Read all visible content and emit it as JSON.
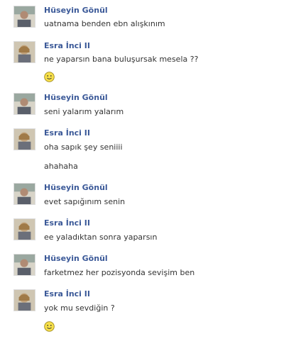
{
  "chat": {
    "blocks": [
      {
        "sender": "Hüseyin Gönül",
        "lines": [
          "uatnama benden ebn alışkınım"
        ]
      },
      {
        "sender": "Esra İnci II",
        "lines": [
          "ne yaparsın bana buluşursak mesela ??"
        ],
        "emoji": "smiley-icon"
      },
      {
        "sender": "Hüseyin Gönül",
        "lines": [
          "seni yalarım yalarım"
        ]
      },
      {
        "sender": "Esra İnci II",
        "lines": [
          "oha sapık şey seniiii",
          "ahahaha"
        ]
      },
      {
        "sender": "Hüseyin Gönül",
        "lines": [
          "evet sapığınım senin"
        ]
      },
      {
        "sender": "Esra İnci II",
        "lines": [
          "ee yaladıktan sonra yaparsın"
        ]
      },
      {
        "sender": "Hüseyin Gönül",
        "lines": [
          "farketmez her pozisyonda sevişim ben"
        ]
      },
      {
        "sender": "Esra İnci II",
        "lines": [
          "yok mu sevdiğin ?"
        ],
        "emoji": "smiley-icon"
      }
    ]
  },
  "colors": {
    "name": "#3b5998",
    "text": "#333333",
    "background": "#ffffff"
  }
}
